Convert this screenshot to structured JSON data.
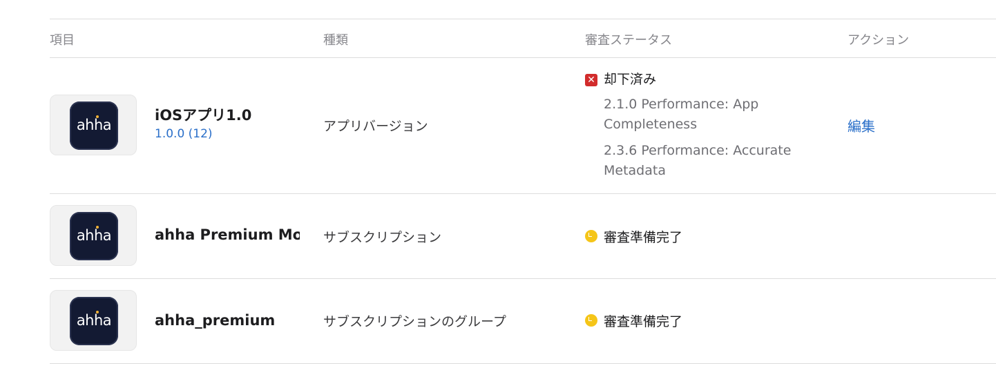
{
  "table": {
    "headers": {
      "item": "項目",
      "type": "種類",
      "status": "審査ステータス",
      "action": "アクション"
    },
    "rows": [
      {
        "name": "iOSアプリ1.0",
        "subtitle": "1.0.0 (12)",
        "icon_text": "ahha",
        "type": "アプリバージョン",
        "status": {
          "icon": "rejected-icon",
          "label": "却下済み",
          "color": "#d22c2c",
          "reasons": [
            "2.1.0 Performance: App Completeness",
            "2.3.6 Performance: Accurate Metadata"
          ]
        },
        "action": "編集"
      },
      {
        "name": "ahha Premium Monthly",
        "icon_text": "ahha",
        "type": "サブスクリプション",
        "status": {
          "icon": "clock-icon",
          "label": "審査準備完了",
          "color": "#f5c518"
        }
      },
      {
        "name": "ahha_premium",
        "icon_text": "ahha",
        "type": "サブスクリプションのグループ",
        "status": {
          "icon": "clock-icon",
          "label": "審査準備完了",
          "color": "#f5c518"
        }
      }
    ]
  },
  "colors": {
    "link": "#2a6fc9",
    "divider": "#dcdcdc",
    "app_icon_bg": "#131a33",
    "app_icon_dot": "#f2b234"
  }
}
